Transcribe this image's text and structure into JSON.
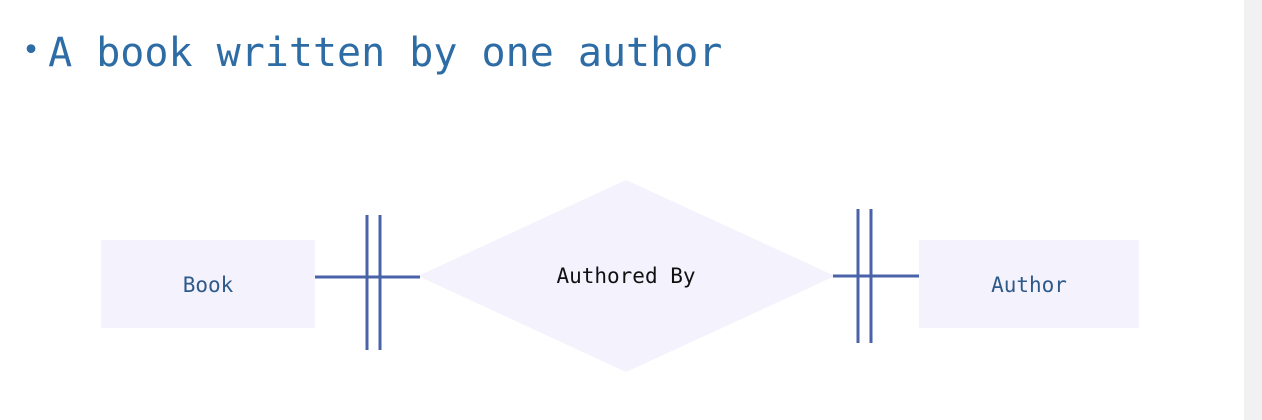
{
  "slide": {
    "bullet": "•",
    "title": "A book written by one author"
  },
  "diagram": {
    "entities": [
      {
        "label": "Book"
      },
      {
        "label": "Author"
      }
    ],
    "relationship": {
      "label": "Authored By"
    },
    "cardinality": {
      "book_side": "one-and-only-one",
      "author_side": "one-and-only-one"
    },
    "colors": {
      "shape_fill": "#f4f2fd",
      "line": "#4a63a8",
      "entity_text": "#2e5a8a",
      "relationship_text": "#111111",
      "title": "#2e6ca5"
    }
  }
}
